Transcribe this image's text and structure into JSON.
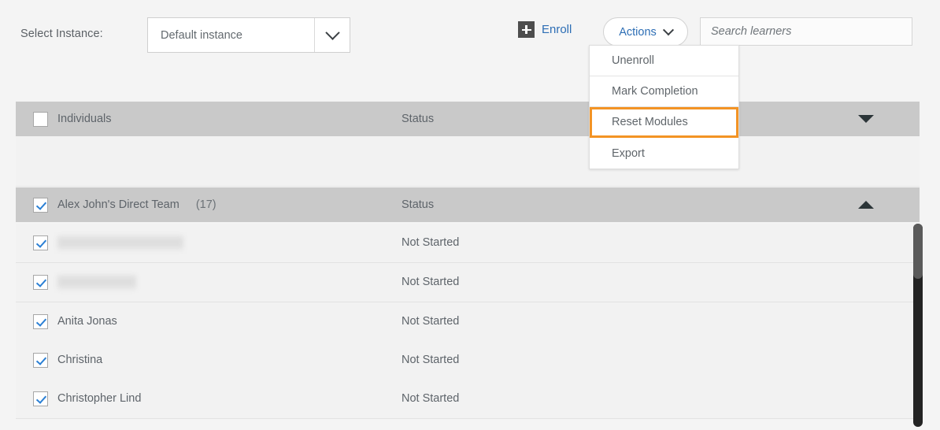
{
  "toolbar": {
    "select_instance_label": "Select Instance:",
    "instance_value": "Default instance",
    "instance_arrow_icon": "chevron-down-icon",
    "enroll_label": "Enroll",
    "enroll_icon": "plus-square-icon",
    "actions_label": "Actions",
    "actions_arrow_icon": "chevron-down-icon",
    "search_placeholder": "Search learners",
    "search_value": ""
  },
  "actions_menu": {
    "items": [
      {
        "label": "Unenroll",
        "highlighted": false
      },
      {
        "label": "Mark Completion",
        "highlighted": false
      },
      {
        "label": "Reset Modules",
        "highlighted": true
      },
      {
        "label": "Export",
        "highlighted": false
      }
    ],
    "highlight_color": "#f39324"
  },
  "table": {
    "groups": [
      {
        "name": "Individuals",
        "count": "",
        "status_header": "Status",
        "checked": false,
        "expanded": false,
        "caret_icon": "caret-down-icon"
      },
      {
        "name": "Alex John's Direct Team",
        "count": "(17)",
        "status_header": "Status",
        "checked": true,
        "expanded": true,
        "caret_icon": "caret-up-icon"
      }
    ],
    "rows": [
      {
        "name": "",
        "redacted": true,
        "redacted_width": 160,
        "status": "Not Started",
        "checked": true
      },
      {
        "name": "",
        "redacted": true,
        "redacted_width": 100,
        "status": "Not Started",
        "checked": true
      },
      {
        "name": "Anita Jonas",
        "redacted": false,
        "status": "Not Started",
        "checked": true
      },
      {
        "name": "Christina",
        "redacted": false,
        "status": "Not Started",
        "checked": true
      },
      {
        "name": "Christopher Lind",
        "redacted": false,
        "status": "Not Started",
        "checked": true
      }
    ]
  },
  "scrollbar": {
    "name": "vertical-scrollbar",
    "thumb_position_pct": 0
  }
}
